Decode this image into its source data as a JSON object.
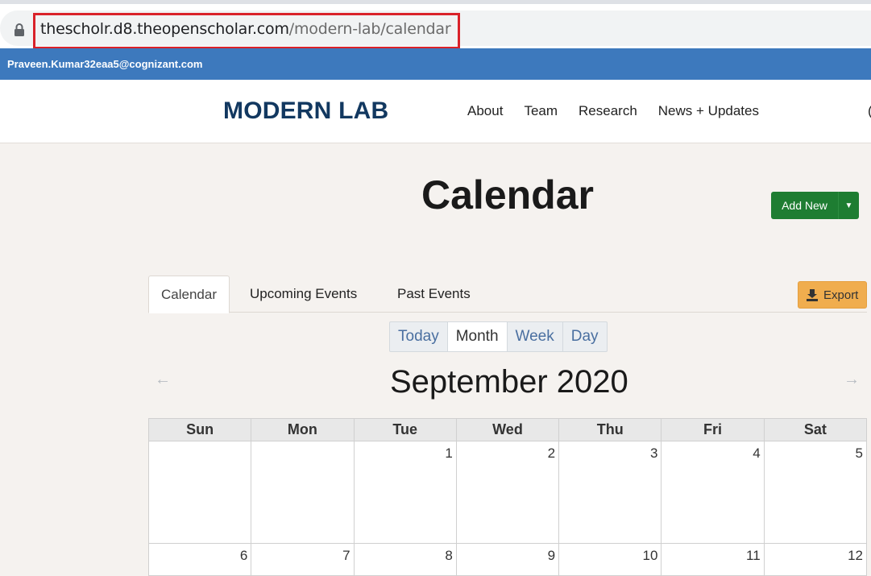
{
  "browser": {
    "url_host": "thescholr.d8.theopenscholar.com",
    "url_path": "/modern-lab/calendar"
  },
  "admin_bar": {
    "user": "Praveen.Kumar32eaa5@cognizant.com"
  },
  "header": {
    "logo": "MODERN LAB",
    "nav": [
      "About",
      "Team",
      "Research",
      "News + Updates"
    ],
    "nav_cutoff": "("
  },
  "page": {
    "title": "Calendar",
    "add_new_label": "Add New"
  },
  "tabs": [
    "Calendar",
    "Upcoming Events",
    "Past Events"
  ],
  "export_label": "Export",
  "views": [
    "Today",
    "Month",
    "Week",
    "Day"
  ],
  "active_view": "Month",
  "month_nav": {
    "title": "September 2020",
    "prev": "←",
    "next": "→"
  },
  "calendar": {
    "weekdays": [
      "Sun",
      "Mon",
      "Tue",
      "Wed",
      "Thu",
      "Fri",
      "Sat"
    ],
    "weeks": [
      [
        "",
        "",
        "1",
        "2",
        "3",
        "4",
        "5"
      ],
      [
        "6",
        "7",
        "8",
        "9",
        "10",
        "11",
        "12"
      ]
    ]
  },
  "colors": {
    "admin_bar": "#3d79bd",
    "logo": "#123860",
    "add_new": "#1e7d32",
    "export": "#f0ad4e",
    "url_highlight": "#d9222a"
  },
  "icons": {
    "lock": "lock-icon",
    "export": "export-icon",
    "caret": "caret-down-icon"
  }
}
